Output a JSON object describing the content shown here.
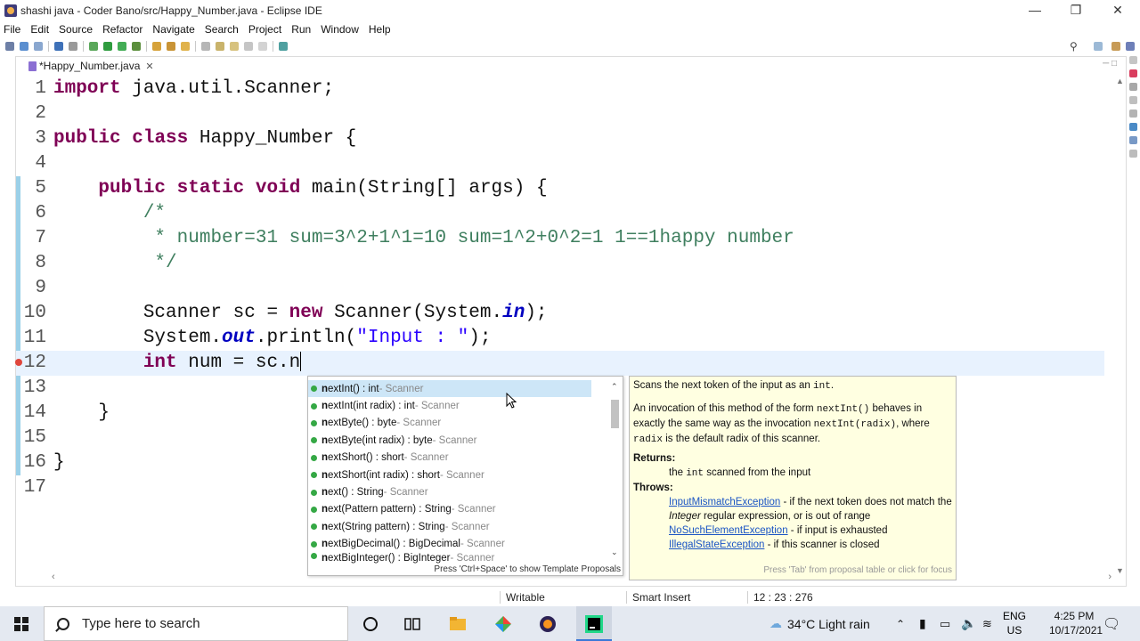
{
  "window": {
    "title": "shashi java - Coder Bano/src/Happy_Number.java - Eclipse IDE"
  },
  "menu": [
    "File",
    "Edit",
    "Source",
    "Refactor",
    "Navigate",
    "Search",
    "Project",
    "Run",
    "Window",
    "Help"
  ],
  "editor": {
    "tab_label": "*Happy_Number.java",
    "lines": [
      {
        "n": "1",
        "parts": [
          [
            "kw",
            "import"
          ],
          [
            "t",
            " java.util.Scanner;"
          ]
        ]
      },
      {
        "n": "2",
        "parts": []
      },
      {
        "n": "3",
        "parts": [
          [
            "kw",
            "public"
          ],
          [
            "t",
            " "
          ],
          [
            "kw",
            "class"
          ],
          [
            "t",
            " Happy_Number {"
          ]
        ]
      },
      {
        "n": "4",
        "parts": []
      },
      {
        "n": "5",
        "parts": [
          [
            "t",
            "    "
          ],
          [
            "kw",
            "public"
          ],
          [
            "t",
            " "
          ],
          [
            "kw",
            "static"
          ],
          [
            "t",
            " "
          ],
          [
            "kw",
            "void"
          ],
          [
            "t",
            " main(String[] args) {"
          ]
        ]
      },
      {
        "n": "6",
        "parts": [
          [
            "t",
            "        "
          ],
          [
            "cm",
            "/*"
          ]
        ]
      },
      {
        "n": "7",
        "parts": [
          [
            "t",
            "        "
          ],
          [
            "cm",
            " * number=31 sum=3^2+1^1=10 sum=1^2+0^2=1 1==1happy number"
          ]
        ]
      },
      {
        "n": "8",
        "parts": [
          [
            "t",
            "        "
          ],
          [
            "cm",
            " */"
          ]
        ]
      },
      {
        "n": "9",
        "parts": []
      },
      {
        "n": "10",
        "parts": [
          [
            "t",
            "        Scanner sc = "
          ],
          [
            "kw",
            "new"
          ],
          [
            "t",
            " Scanner(System."
          ],
          [
            "fld",
            "in"
          ],
          [
            "t",
            ");"
          ]
        ]
      },
      {
        "n": "11",
        "parts": [
          [
            "t",
            "        System."
          ],
          [
            "fld",
            "out"
          ],
          [
            "t",
            ".println("
          ],
          [
            "st",
            "\"Input : \""
          ],
          [
            "t",
            ");"
          ]
        ]
      },
      {
        "n": "12",
        "parts": [
          [
            "t",
            "        "
          ],
          [
            "kw",
            "int"
          ],
          [
            "t",
            " num = sc.n"
          ]
        ]
      },
      {
        "n": "13",
        "parts": []
      },
      {
        "n": "14",
        "parts": [
          [
            "t",
            "    }"
          ]
        ]
      },
      {
        "n": "15",
        "parts": []
      },
      {
        "n": "16",
        "parts": [
          [
            "t",
            "}"
          ]
        ]
      },
      {
        "n": "17",
        "parts": []
      }
    ]
  },
  "completion": {
    "items": [
      {
        "prefix": "n",
        "rest": "extInt() : int",
        "type": "Scanner"
      },
      {
        "prefix": "n",
        "rest": "extInt(int radix) : int",
        "type": "Scanner"
      },
      {
        "prefix": "n",
        "rest": "extByte() : byte",
        "type": "Scanner"
      },
      {
        "prefix": "n",
        "rest": "extByte(int radix) : byte",
        "type": "Scanner"
      },
      {
        "prefix": "n",
        "rest": "extShort() : short",
        "type": "Scanner"
      },
      {
        "prefix": "n",
        "rest": "extShort(int radix) : short",
        "type": "Scanner"
      },
      {
        "prefix": "n",
        "rest": "ext() : String",
        "type": "Scanner"
      },
      {
        "prefix": "n",
        "rest": "ext(Pattern pattern) : String",
        "type": "Scanner"
      },
      {
        "prefix": "n",
        "rest": "ext(String pattern) : String",
        "type": "Scanner"
      },
      {
        "prefix": "n",
        "rest": "extBigDecimal() : BigDecimal",
        "type": "Scanner"
      },
      {
        "prefix": "n",
        "rest": "extBigInteger() : BigInteger",
        "type": "Scanner"
      }
    ],
    "footer": "Press 'Ctrl+Space' to show Template Proposals"
  },
  "javadoc": {
    "summary_pre": "Scans the next token of the input as an ",
    "summary_code": "int",
    "summary_post": ".",
    "p2_a": "An invocation of this method of the form ",
    "p2_code1": "nextInt()",
    "p2_b": " behaves in exactly the same way as the invocation ",
    "p2_code2": "nextInt(radix)",
    "p2_c": ", where ",
    "p2_code3": "radix",
    "p2_d": " is the default radix of this scanner.",
    "returns_label": "Returns:",
    "returns_pre": "the ",
    "returns_code": "int",
    "returns_post": " scanned from the input",
    "throws_label": "Throws:",
    "t1_link": "InputMismatchException",
    "t1_text_a": " - if the next token does not match the ",
    "t1_em": "Integer",
    "t1_text_b": " regular expression, or is out of range",
    "t2_link": "NoSuchElementException",
    "t2_text": " - if input is exhausted",
    "t3_link": "IllegalStateException",
    "t3_text": " - if this scanner is closed",
    "footer": "Press 'Tab' from proposal table or click for focus"
  },
  "status": {
    "writable": "Writable",
    "insert": "Smart Insert",
    "position": "12 : 23 : 276"
  },
  "taskbar": {
    "search_placeholder": "Type here to search",
    "weather": "34°C  Light rain",
    "lang": "ENG",
    "region": "US",
    "time": "4:25 PM",
    "date": "10/17/2021"
  },
  "colors": {
    "keyword": "#7f0055",
    "comment": "#3f7f5f",
    "string": "#2a00ff",
    "field": "#0000c0",
    "current_line": "#e8f2fe"
  }
}
